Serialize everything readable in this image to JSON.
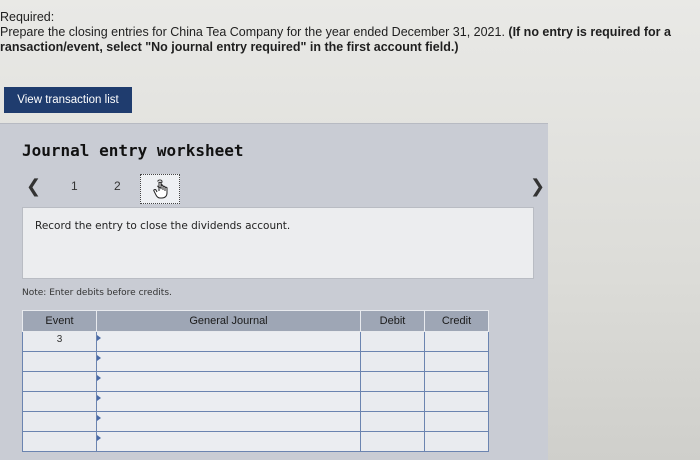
{
  "instructions": {
    "title": "Required:",
    "line1_prefix": "Prepare the closing entries for China Tea Company for the year ended December 31, 2021. ",
    "line1_bold": "(If no entry is required for a",
    "line2_bold": "ransaction/event, select \"No journal entry required\" in the first account field.)"
  },
  "view_button_label": "View transaction list",
  "worksheet": {
    "title": "Journal entry worksheet",
    "pages": [
      "1",
      "2",
      "3"
    ],
    "current_page": 3,
    "instruction": "Record the entry to close the dividends account.",
    "note": "Note: Enter debits before credits."
  },
  "table": {
    "headers": [
      "Event",
      "General Journal",
      "Debit",
      "Credit"
    ],
    "rows": [
      {
        "event": "3",
        "account": "",
        "debit": "",
        "credit": ""
      },
      {
        "event": "",
        "account": "",
        "debit": "",
        "credit": ""
      },
      {
        "event": "",
        "account": "",
        "debit": "",
        "credit": ""
      },
      {
        "event": "",
        "account": "",
        "debit": "",
        "credit": ""
      },
      {
        "event": "",
        "account": "",
        "debit": "",
        "credit": ""
      },
      {
        "event": "",
        "account": "",
        "debit": "",
        "credit": ""
      }
    ]
  },
  "icons": {
    "prev": "chevron-left-icon",
    "next": "chevron-right-icon",
    "hand": "hand-pointer-icon"
  },
  "colors": {
    "button": "#1f3c6e",
    "header": "#9ea6b5",
    "cell_border": "#6b84b0"
  }
}
